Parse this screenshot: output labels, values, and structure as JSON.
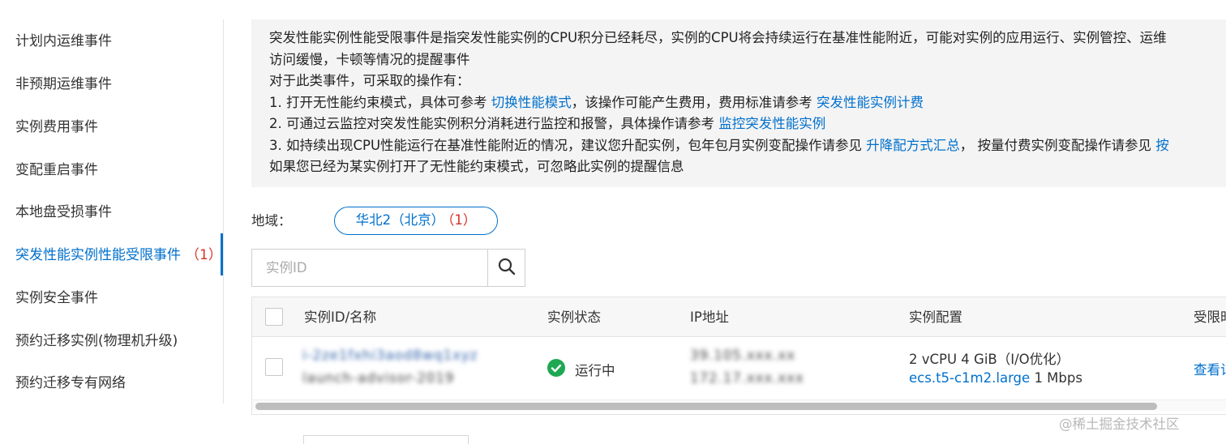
{
  "sidebar": {
    "items": [
      {
        "label": "计划内运维事件"
      },
      {
        "label": "非预期运维事件"
      },
      {
        "label": "实例费用事件"
      },
      {
        "label": "变配重启事件"
      },
      {
        "label": "本地盘受损事件"
      },
      {
        "label": "突发性能实例性能受限事件",
        "count": "（1）",
        "active": true
      },
      {
        "label": "实例安全事件"
      },
      {
        "label": "预约迁移实例(物理机升级)"
      },
      {
        "label": "预约迁移专有网络"
      }
    ]
  },
  "notice": {
    "line1": "突发性能实例性能受限事件是指突发性能实例的CPU积分已经耗尽，实例的CPU将会持续运行在基准性能附近，可能对实例的应用运行、实例管控、运维",
    "line2": "访问缓慢，卡顿等情况的提醒事件",
    "line3": "对于此类事件，可采取的操作有：",
    "line4_prefix": "1. 打开无性能约束模式，具体可参考 ",
    "line4_link1": "切换性能模式",
    "line4_mid": "，该操作可能产生费用，费用标准请参考 ",
    "line4_link2": "突发性能实例计费",
    "line5_prefix": "2. 可通过云监控对突发性能实例积分消耗进行监控和报警，具体操作请参考 ",
    "line5_link": "监控突发性能实例",
    "line6_prefix": "3. 如持续出现CPU性能运行在基准性能附近的情况，建议您升配实例，包年包月实例变配操作请参见 ",
    "line6_link1": "升降配方式汇总",
    "line6_mid": "， 按量付费实例变配操作请参见 ",
    "line6_link2": "按",
    "line7": "如果您已经为某实例打开了无性能约束模式，可忽略此实例的提醒信息"
  },
  "region": {
    "label": "地域：",
    "chip_label": "华北2（北京）",
    "chip_count": "（1）"
  },
  "search": {
    "placeholder": "实例ID",
    "value": ""
  },
  "table": {
    "headers": {
      "instance": "实例ID/名称",
      "status": "实例状态",
      "ip": "IP地址",
      "config": "实例配置",
      "limited": "受限时"
    },
    "rows": [
      {
        "instance_id": "i-2ze1fxhi3aod8wq1xyz",
        "instance_name": "launch-advisor-2019",
        "status": "运行中",
        "ip_public": "39.105.xxx.xx",
        "ip_private": "172.17.xxx.xxx",
        "config_spec": "2 vCPU 4 GiB（I/O优化）",
        "config_type": "ecs.t5-c1m2.large",
        "config_bandwidth": "1 Mbps",
        "action": "查看记"
      }
    ]
  },
  "watermark": "@稀土掘金技术社区",
  "colors": {
    "accent": "#0070cc",
    "count_red": "#d93026",
    "status_green": "#1ea851"
  }
}
